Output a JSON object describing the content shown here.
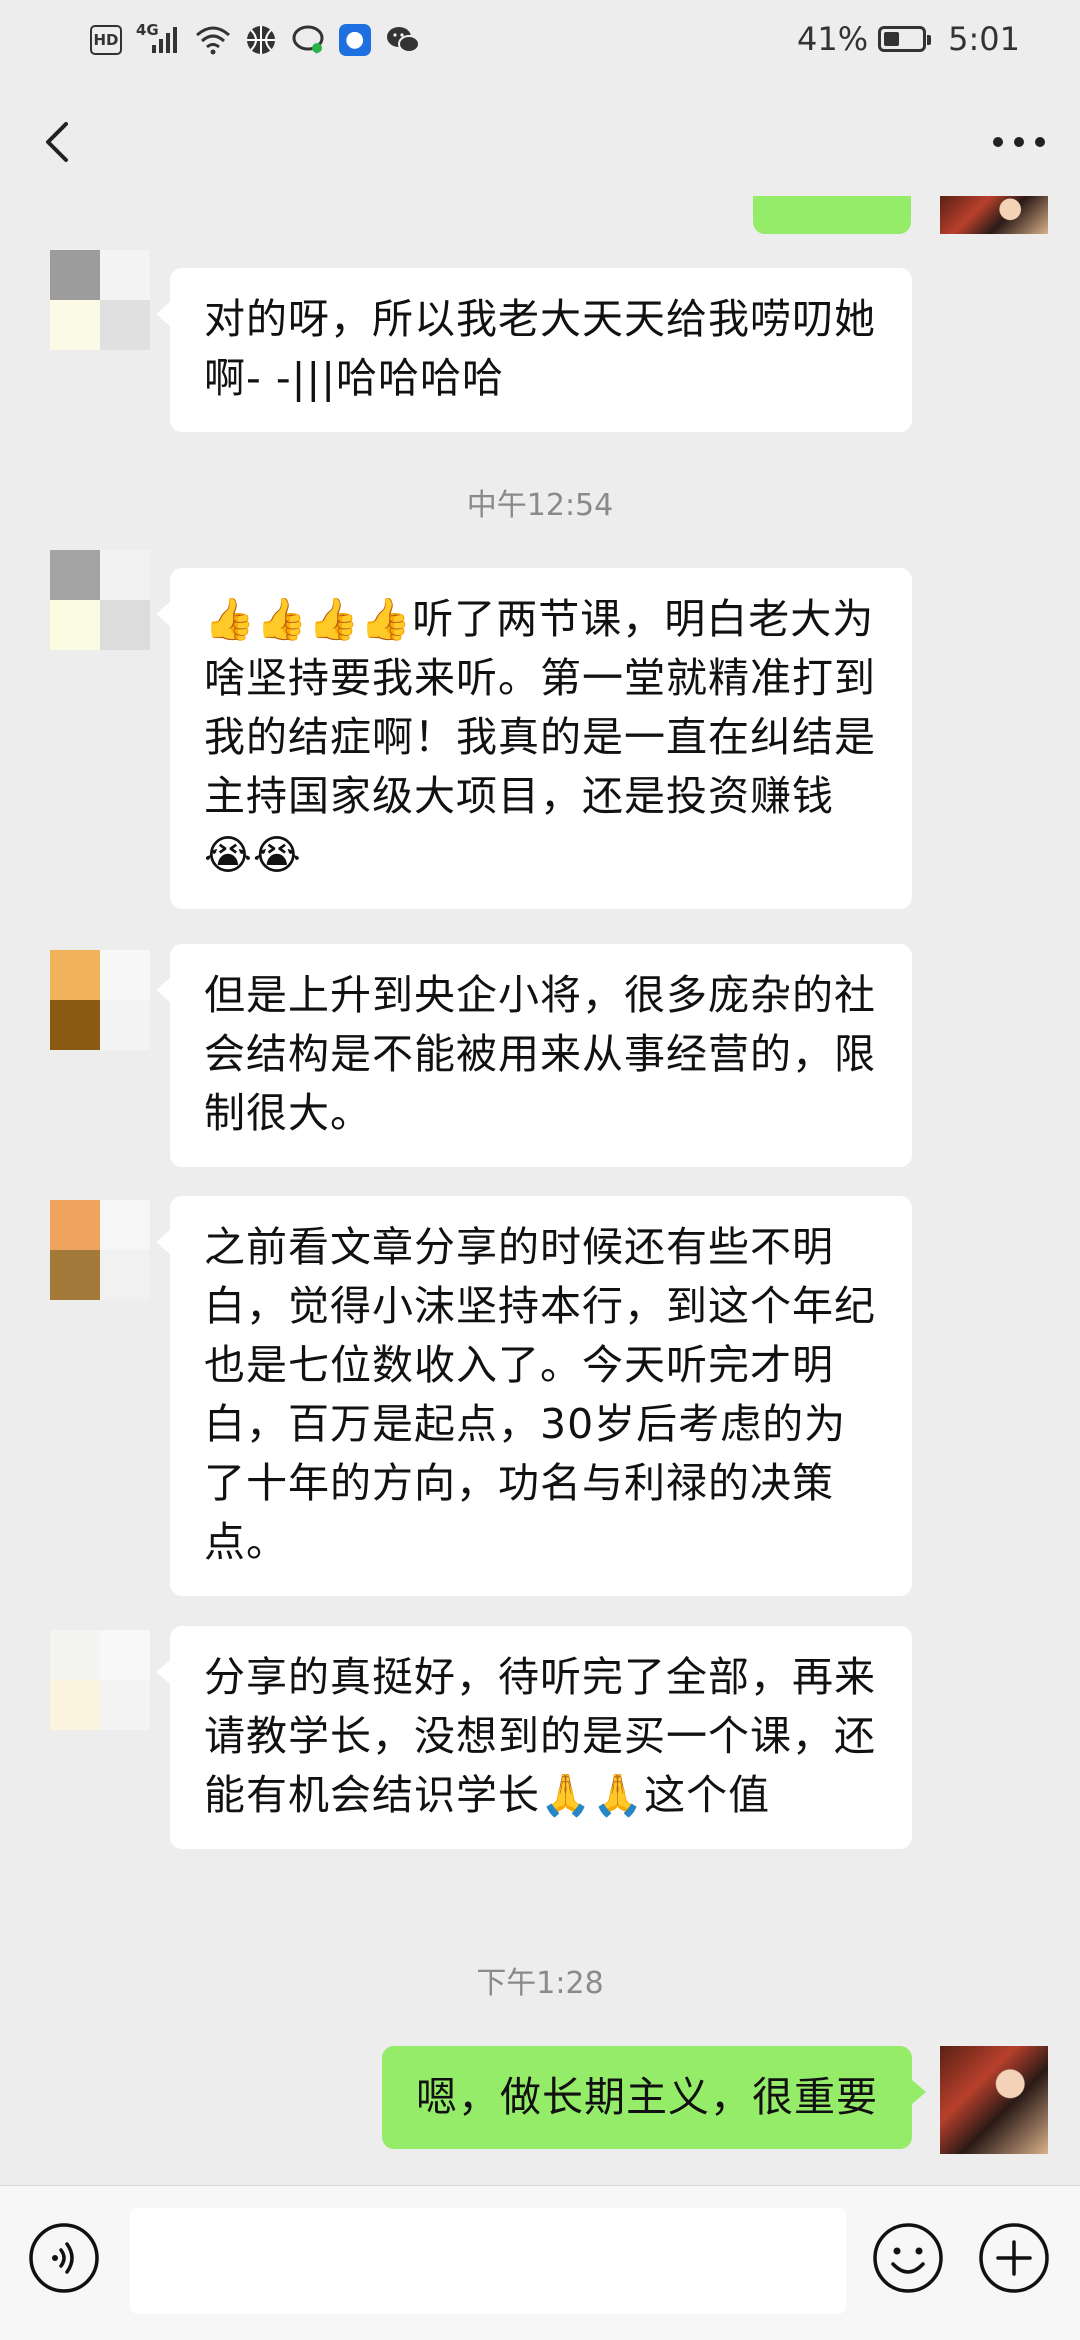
{
  "status_bar": {
    "network_label": "4G",
    "hd_label": "HD",
    "battery_percent": "41%",
    "battery_level": 0.41,
    "time": "5:01",
    "icons": [
      "hd-icon",
      "signal-icon",
      "wifi-icon",
      "basketball-icon",
      "chat-bubble-icon",
      "app-badge-icon",
      "wechat-icon"
    ]
  },
  "nav": {
    "back_icon": "chevron-left-icon",
    "more_icon": "more-dots-icon"
  },
  "messages": [
    {
      "type": "received",
      "text": "对的呀，所以我老大天天给我唠叨她啊- -|||哈哈哈哈"
    },
    {
      "type": "time",
      "text": "中午12:54"
    },
    {
      "type": "received",
      "text": "👍👍👍👍听了两节课，明白老大为啥坚持要我来听。第一堂就精准打到我的结症啊！我真的是一直在纠结是主持国家级大项目，还是投资赚钱😭😭"
    },
    {
      "type": "received",
      "text": "但是上升到央企小将，很多庞杂的社会结构是不能被用来从事经营的，限制很大。"
    },
    {
      "type": "received",
      "text": "之前看文章分享的时候还有些不明白，觉得小沫坚持本行，到这个年纪也是七位数收入了。今天听完才明白，百万是起点，30岁后考虑的为了十年的方向，功名与利禄的决策点。"
    },
    {
      "type": "received",
      "text": "分享的真挺好，待听完了全部，再来请教学长，没想到的是买一个课，还能有机会结识学长🙏🙏这个值"
    },
    {
      "type": "time",
      "text": "下午1:28"
    },
    {
      "type": "sent",
      "text": "嗯，做长期主义，很重要"
    }
  ],
  "input_bar": {
    "text_value": "",
    "voice_icon": "voice-icon",
    "emoji_icon": "emoji-icon",
    "plus_icon": "plus-circle-icon"
  },
  "colors": {
    "background": "#ededed",
    "sent_bubble": "#95ec69",
    "received_bubble": "#ffffff",
    "time_text": "#8a8a8a"
  }
}
